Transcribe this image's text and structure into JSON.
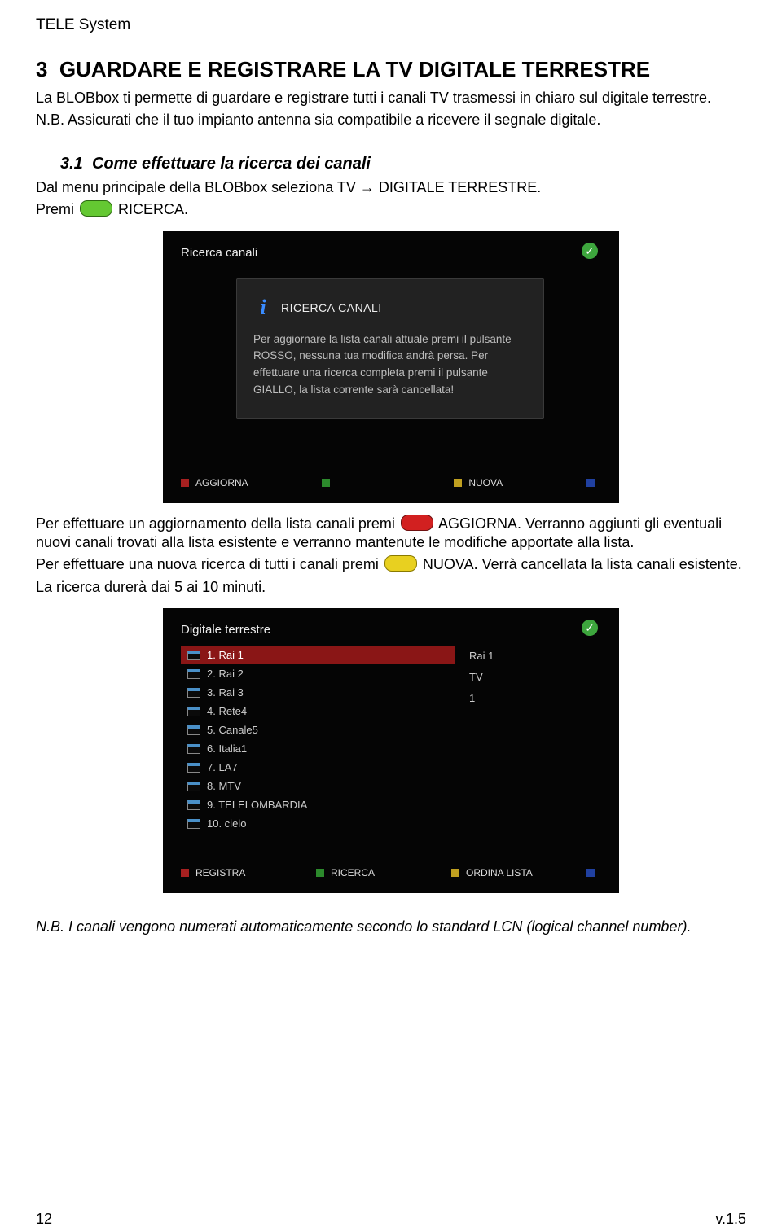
{
  "header": {
    "brand": "TELE System"
  },
  "section": {
    "number": "3",
    "title": "GUARDARE E REGISTRARE LA TV DIGITALE TERRESTRE",
    "intro_l1": "La BLOBbox ti permette di guardare e registrare tutti i canali TV trasmessi in chiaro sul digitale terrestre.",
    "nb": "N.B. Assicurati che il tuo impianto antenna sia compatibile a ricevere il segnale digitale."
  },
  "subsection31": {
    "number": "3.1",
    "title": "Come effettuare la ricerca dei canali",
    "line1": "Dal menu principale della BLOBbox seleziona TV → DIGITALE TERRESTRE.",
    "line2a": "Premi ",
    "line2b": " RICERCA."
  },
  "shot1": {
    "title": "Ricerca canali",
    "panel_title": "RICERCA CANALI",
    "panel_text": "Per aggiornare la lista canali attuale premi il pulsante ROSSO, nessuna tua modifica andrà persa. Per effettuare una ricerca completa premi il pulsante GIALLO, la lista corrente sarà cancellata!",
    "legend": {
      "red": "AGGIORNA",
      "green": "",
      "yellow": "NUOVA",
      "blue": ""
    }
  },
  "midtext": {
    "p1a": "Per effettuare un aggiornamento della lista canali premi ",
    "p1b": " AGGIORNA. Verranno aggiunti gli eventuali nuovi canali trovati alla lista esistente e verranno mantenute le modifiche apportate alla lista.",
    "p2a": "Per effettuare una nuova ricerca di tutti i canali premi ",
    "p2b": " NUOVA. Verrà cancellata la lista canali esistente.",
    "p3": "La ricerca durerà dai 5 ai 10 minuti."
  },
  "shot2": {
    "title": "Digitale terrestre",
    "selected_name": "Rai 1",
    "selected_type": "TV",
    "selected_num": "1",
    "channels": [
      {
        "n": "1",
        "name": "Rai 1",
        "sel": true
      },
      {
        "n": "2",
        "name": "Rai 2"
      },
      {
        "n": "3",
        "name": "Rai 3"
      },
      {
        "n": "4",
        "name": "Rete4"
      },
      {
        "n": "5",
        "name": "Canale5"
      },
      {
        "n": "6",
        "name": "Italia1"
      },
      {
        "n": "7",
        "name": "LA7"
      },
      {
        "n": "8",
        "name": "MTV"
      },
      {
        "n": "9",
        "name": "TELELOMBARDIA"
      },
      {
        "n": "10",
        "name": "cielo"
      }
    ],
    "legend": {
      "red": "REGISTRA",
      "green": "RICERCA",
      "yellow": "ORDINA LISTA",
      "blue": ""
    }
  },
  "closing_note": "N.B. I canali vengono numerati automaticamente secondo lo standard LCN (logical channel number).",
  "footer": {
    "page": "12",
    "version": "v.1.5"
  }
}
